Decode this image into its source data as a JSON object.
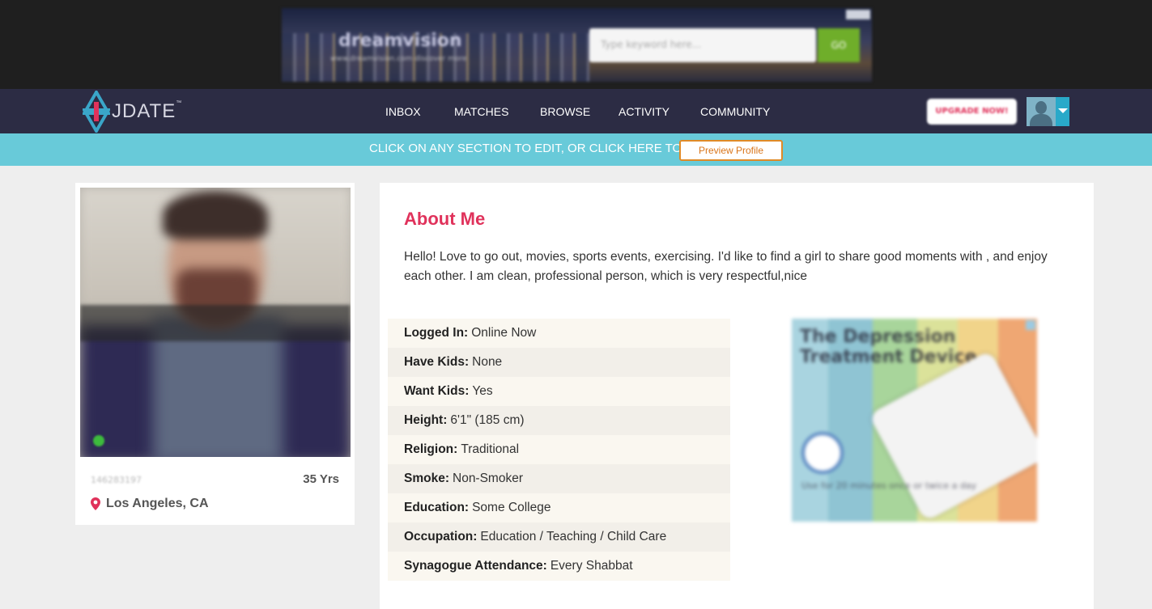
{
  "top_ad": {
    "brand": "dreamvision",
    "tagline": "www.dreamvision.com discover more",
    "search_placeholder": "Type keyword here...",
    "search_button": "GO"
  },
  "header": {
    "logo_text": "JDATE",
    "logo_tm": "™",
    "nav": [
      {
        "label": "INBOX"
      },
      {
        "label": "MATCHES"
      },
      {
        "label": "BROWSE"
      },
      {
        "label": "ACTIVITY"
      },
      {
        "label": "COMMUNITY"
      }
    ],
    "upgrade_label": "UPGRADE NOW!"
  },
  "edit_banner": {
    "message": "CLICK ON ANY SECTION TO EDIT, OR CLICK HERE TO",
    "preview_label": "Preview Profile"
  },
  "profile_card": {
    "member_id": "146283197",
    "age": "35 Yrs",
    "location": "Los Angeles, CA"
  },
  "about": {
    "title": "About Me",
    "text": "Hello! Love to go out, movies, sports events, exercising. I'd like to find a girl to share good moments with , and enjoy each other. I am clean, professional person, which is very respectful,nice"
  },
  "facts": [
    {
      "label": "Logged In:",
      "value": "Online Now"
    },
    {
      "label": "Have Kids:",
      "value": "None"
    },
    {
      "label": "Want Kids:",
      "value": "Yes"
    },
    {
      "label": "Height:",
      "value": "6'1\" (185 cm)"
    },
    {
      "label": "Religion:",
      "value": "Traditional"
    },
    {
      "label": "Smoke:",
      "value": "Non-Smoker"
    },
    {
      "label": "Education:",
      "value": "Some College"
    },
    {
      "label": "Occupation:",
      "value": "Education / Teaching / Child Care"
    },
    {
      "label": "Synagogue Attendance:",
      "value": "Every Shabbat"
    }
  ],
  "side_ad": {
    "headline": "The Depression Treatment Device",
    "footer": "Use for 20 minutes once or twice a day"
  },
  "colors": {
    "header_bg": "#2c2c44",
    "banner_bg": "#68cad9",
    "accent_pink": "#e0325b",
    "preview_orange": "#e08a27"
  }
}
